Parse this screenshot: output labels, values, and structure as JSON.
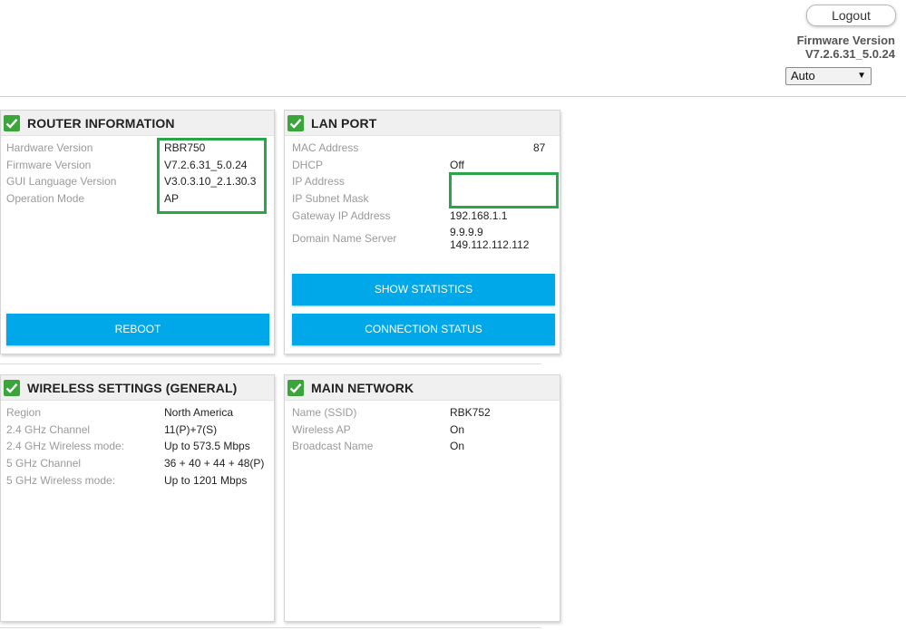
{
  "header": {
    "logout_label": "Logout",
    "firmware_label": "Firmware Version",
    "firmware_value": "V7.2.6.31_5.0.24",
    "language_select_value": "Auto"
  },
  "router_info": {
    "title": "ROUTER INFORMATION",
    "rows": [
      {
        "label": "Hardware Version",
        "value": "RBR750"
      },
      {
        "label": "Firmware Version",
        "value": "V7.2.6.31_5.0.24"
      },
      {
        "label": "GUI Language Version",
        "value": "V3.0.3.10_2.1.30.3"
      },
      {
        "label": "Operation Mode",
        "value": "AP"
      }
    ],
    "reboot_label": "REBOOT"
  },
  "lan_port": {
    "title": "LAN PORT",
    "rows": [
      {
        "label": "MAC Address",
        "value": "87"
      },
      {
        "label": "DHCP",
        "value": "Off"
      },
      {
        "label": "IP Address",
        "value": ""
      },
      {
        "label": "IP Subnet Mask",
        "value": ""
      },
      {
        "label": "Gateway IP Address",
        "value": "192.168.1.1"
      },
      {
        "label": "Domain Name Server",
        "value": "9.9.9.9",
        "value2": "149.112.112.112"
      }
    ],
    "show_statistics_label": "SHOW STATISTICS",
    "connection_status_label": "CONNECTION STATUS"
  },
  "wireless": {
    "title": "WIRELESS SETTINGS (GENERAL)",
    "rows": [
      {
        "label": "Region",
        "value": "North America"
      },
      {
        "label": "2.4 GHz Channel",
        "value": "11(P)+7(S)"
      },
      {
        "label": "2.4 GHz Wireless mode:",
        "value": "Up to 573.5 Mbps"
      },
      {
        "label": "5 GHz Channel",
        "value": "36 + 40 + 44 + 48(P)"
      },
      {
        "label": "5 GHz Wireless mode:",
        "value": "Up to 1201 Mbps"
      }
    ]
  },
  "main_network": {
    "title": "MAIN NETWORK",
    "rows": [
      {
        "label": "Name (SSID)",
        "value": "RBK752"
      },
      {
        "label": "Wireless AP",
        "value": "On"
      },
      {
        "label": "Broadcast Name",
        "value": "On"
      }
    ]
  },
  "colors": {
    "button_blue": "#00a7e9",
    "check_green": "#3aa53a",
    "highlight_green": "#27a64a"
  }
}
